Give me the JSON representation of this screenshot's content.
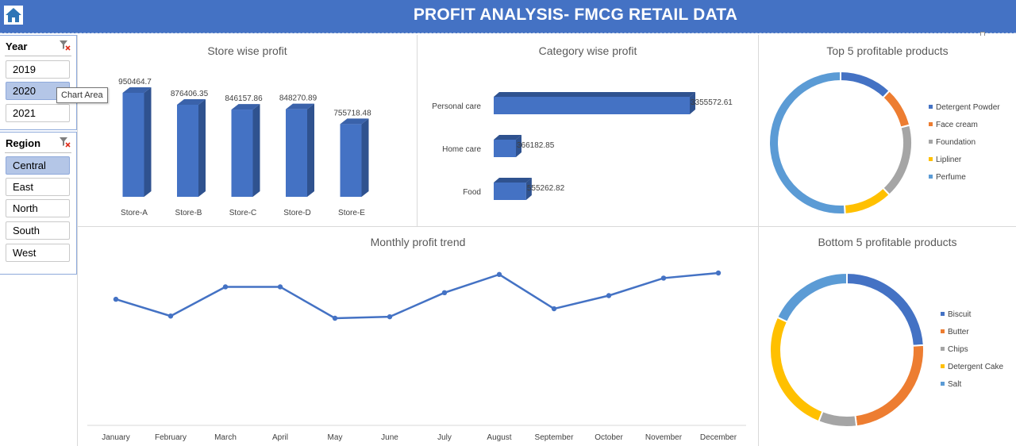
{
  "header": {
    "title": "PROFIT ANALYSIS- FMCG RETAIL DATA"
  },
  "icons": {
    "home": "home-icon",
    "filter_clear": "filter-clear-icon"
  },
  "slicers": {
    "year": {
      "title": "Year",
      "items": [
        "2019",
        "2020",
        "2021"
      ],
      "selected": "2020"
    },
    "region": {
      "title": "Region",
      "items": [
        "Central",
        "East",
        "North",
        "South",
        "West"
      ],
      "selected": "Central"
    }
  },
  "tooltip": {
    "text": "Chart Area"
  },
  "colors": {
    "header": "#4472c4",
    "bar": "#4472c4",
    "line": "#4472c4",
    "donut": [
      "#4472c4",
      "#ed7d31",
      "#a5a5a5",
      "#ffc000",
      "#5b9bd5"
    ]
  },
  "chart_data": [
    {
      "id": "store",
      "type": "bar",
      "title": "Store wise profit",
      "categories": [
        "Store-A",
        "Store-B",
        "Store-C",
        "Store-D",
        "Store-E"
      ],
      "values": [
        950464.7,
        876406.35,
        846157.86,
        848270.89,
        755718.48
      ],
      "labels": [
        "950464.7",
        "876406.35",
        "846157.86",
        "848270.89",
        "755718.48"
      ]
    },
    {
      "id": "category",
      "type": "bar",
      "orientation": "horizontal",
      "title": "Category wise profit",
      "categories": [
        "Personal care",
        "Home care",
        "Food"
      ],
      "values": [
        3355572.61,
        366182.85,
        555262.82
      ],
      "labels": [
        "3355572.61",
        "366182.85",
        "555262.82"
      ]
    },
    {
      "id": "top5",
      "type": "pie",
      "style": "donut",
      "title": "Top 5 profitable products",
      "legend_position": "right",
      "categories": [
        "Detergent Powder",
        "Face cream",
        "Foundation",
        "Lipliner",
        "Perfume"
      ],
      "values": [
        12,
        9,
        17,
        11,
        51
      ]
    },
    {
      "id": "monthly",
      "type": "line",
      "title": "Monthly profit trend",
      "categories": [
        "January",
        "February",
        "March",
        "April",
        "May",
        "June",
        "July",
        "August",
        "September",
        "October",
        "November",
        "December"
      ],
      "values": [
        63,
        40,
        80,
        80,
        37,
        39,
        72,
        97,
        50,
        68,
        92,
        99
      ]
    },
    {
      "id": "bottom5",
      "type": "pie",
      "style": "donut",
      "title": "Bottom 5 profitable products",
      "legend_position": "right",
      "categories": [
        "Biscuit",
        "Butter",
        "Chips",
        "Detergent Cake",
        "Salt"
      ],
      "values": [
        24,
        24,
        8,
        26,
        18
      ]
    }
  ]
}
